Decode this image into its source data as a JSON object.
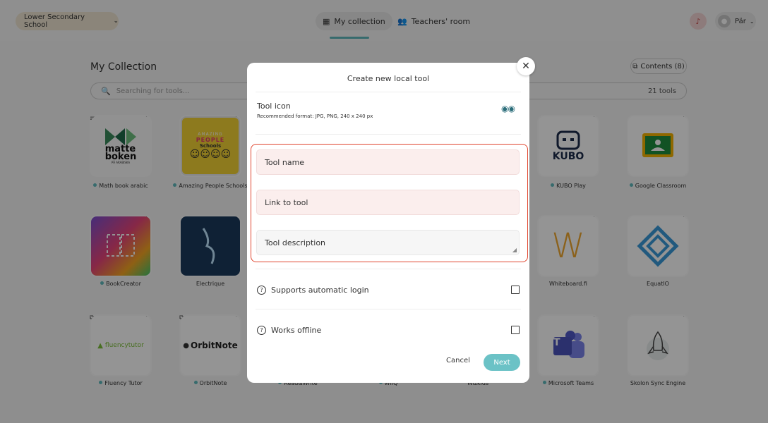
{
  "header": {
    "school_select": "Lower Secondary School",
    "tabs": [
      {
        "label": "My collection",
        "icon": "grid-icon",
        "active": true
      },
      {
        "label": "Teachers' room",
        "icon": "people-icon",
        "active": false
      }
    ],
    "user_name": "Pär"
  },
  "main": {
    "title": "My Collection",
    "contents_button": "Contents (8)",
    "search_placeholder": "Searching for tools...",
    "tool_count": "21 tools"
  },
  "tools": {
    "math_book_arabic": {
      "label": "Math book arabic",
      "logo_text_1": "matte",
      "logo_text_2": "boken",
      "logo_text_3": "PÅ ARABISKA"
    },
    "amazing_people": {
      "label": "Amazing People Schools",
      "logo_text_1": "AMAZING",
      "logo_text_2": "PEOPLE",
      "logo_text_3": "Schools"
    },
    "kubo": {
      "label": "KUBO Play",
      "logo_text": "KUBO"
    },
    "google_classroom": {
      "label": "Google Classroom"
    },
    "bookcreator": {
      "label": "BookCreator"
    },
    "electrique": {
      "label": "Electrique"
    },
    "whiteboard": {
      "label": "Whiteboard.fi",
      "logo_text": "W"
    },
    "equatio": {
      "label": "EquatIO"
    },
    "fluency": {
      "label": "Fluency Tutor",
      "logo_text": "fluencytutor"
    },
    "orbitnote": {
      "label": "OrbitNote",
      "logo_text": "OrbitNote"
    },
    "readwrite": {
      "label": "Read&Write"
    },
    "wiiq": {
      "label": "WIIQ"
    },
    "wizkids": {
      "label": "Wizkids"
    },
    "teams": {
      "label": "Microsoft Teams",
      "logo_text": "T"
    },
    "skolon": {
      "label": "Skolon Sync Engine"
    }
  },
  "modal": {
    "title": "Create new local tool",
    "icon_title": "Tool icon",
    "icon_subtitle": "Recommended format: JPG, PNG, 240 x 240 px",
    "tool_name": "Tool name",
    "link": "Link to tool",
    "description": "Tool description",
    "supports_login": "Supports automatic login",
    "works_offline": "Works offline",
    "cancel": "Cancel",
    "next": "Next"
  },
  "colors": {
    "accent": "#5fb8bc",
    "error_outline": "#e0452e",
    "field_error_bg": "#fbeeed"
  }
}
